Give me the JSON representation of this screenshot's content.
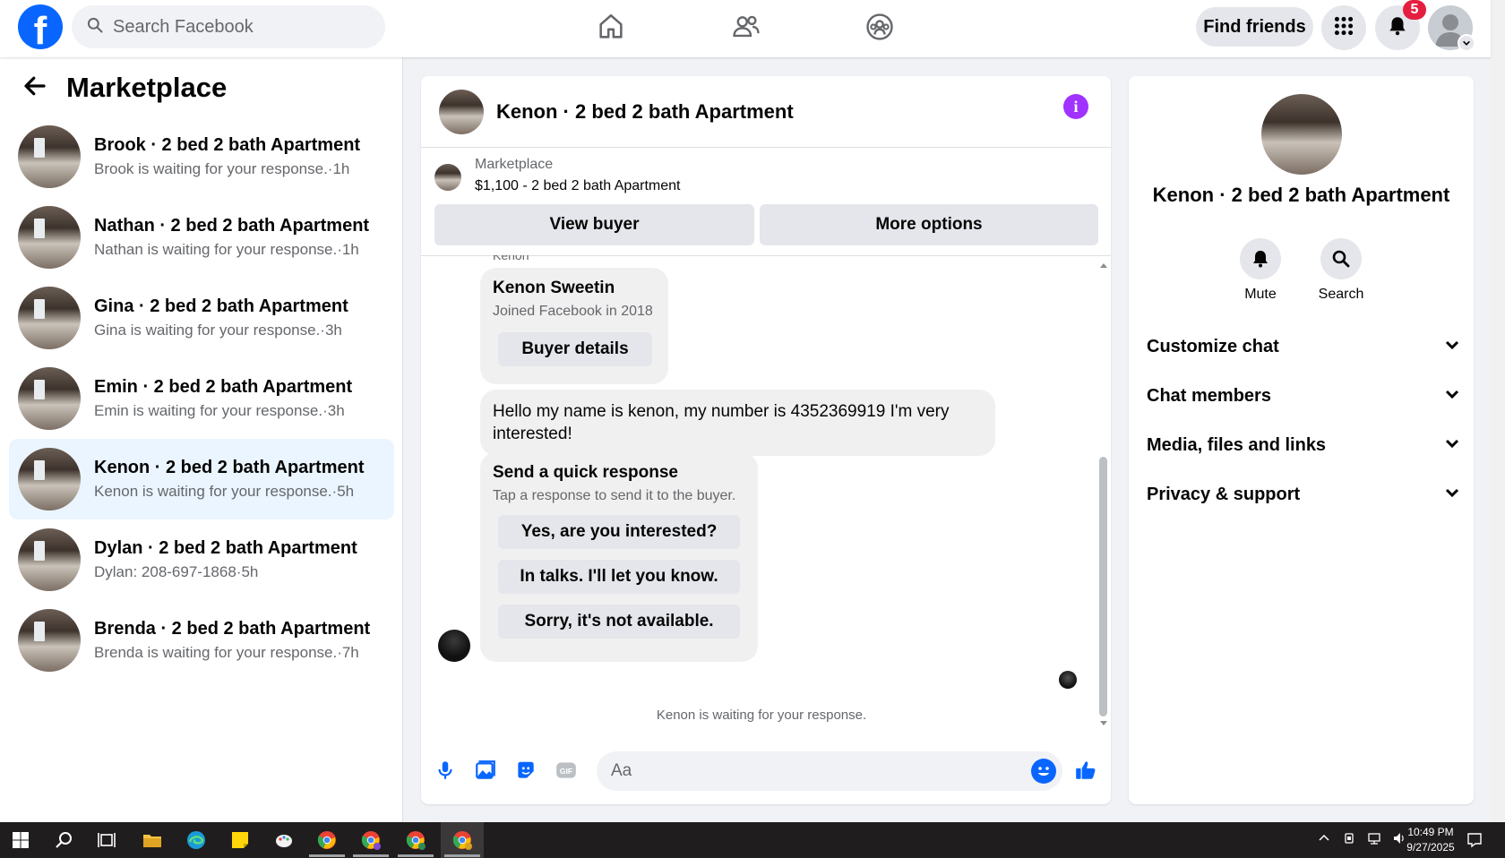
{
  "topbar": {
    "logo": "f",
    "search_placeholder": "Search Facebook",
    "find_friends": "Find friends",
    "notification_count": "5",
    "nav_icons": [
      "home-icon",
      "friends-icon",
      "groups-icon"
    ]
  },
  "sidebar": {
    "title": "Marketplace",
    "conversations": [
      {
        "title": "Brook · 2 bed 2 bath Apartment",
        "sub": "Brook is waiting for your response.·1h",
        "active": false
      },
      {
        "title": "Nathan · 2 bed 2 bath Apartment",
        "sub": "Nathan is waiting for your response.·1h",
        "active": false
      },
      {
        "title": "Gina · 2 bed 2 bath Apartment",
        "sub": "Gina is waiting for your response.·3h",
        "active": false
      },
      {
        "title": "Emin · 2 bed 2 bath Apartment",
        "sub": "Emin is waiting for your response.·3h",
        "active": false
      },
      {
        "title": "Kenon · 2 bed 2 bath Apartment",
        "sub": "Kenon is waiting for your response.·5h",
        "active": true
      },
      {
        "title": "Dylan · 2 bed 2 bath Apartment",
        "sub": "Dylan: 208-697-1868·5h",
        "active": false
      },
      {
        "title": "Brenda · 2 bed 2 bath Apartment",
        "sub": "Brenda is waiting for your response.·7h",
        "active": false
      }
    ]
  },
  "chat": {
    "title": "Kenon · 2 bed 2 bath Apartment",
    "listing_category": "Marketplace",
    "listing_price": "$1,100 - 2 bed 2 bath Apartment",
    "view_buyer": "View buyer",
    "more_options": "More options",
    "sender_label": "Kenon",
    "buyer_name": "Kenon Sweetin",
    "buyer_joined": "Joined Facebook in 2018",
    "buyer_details": "Buyer details",
    "message": "Hello my name is kenon, my number is 4352369919 I'm very interested!",
    "quick_title": "Send a quick response",
    "quick_sub": "Tap a response to send it to the buyer.",
    "quick_responses": [
      "Yes, are you interested?",
      "In talks. I'll let you know.",
      "Sorry, it's not available."
    ],
    "waiting": "Kenon is waiting for your response.",
    "composer_placeholder": "Aa"
  },
  "info_panel": {
    "title": "Kenon · 2 bed 2 bath Apartment",
    "mute": "Mute",
    "search": "Search",
    "sections": [
      "Customize chat",
      "Chat members",
      "Media, files and links",
      "Privacy & support"
    ]
  },
  "taskbar": {
    "time": "10:49 PM",
    "date": "9/27/2025"
  },
  "colors": {
    "brand": "#0866ff",
    "active_row": "#ebf5ff",
    "info": "#a033ff",
    "badge": "#e41e3f"
  }
}
